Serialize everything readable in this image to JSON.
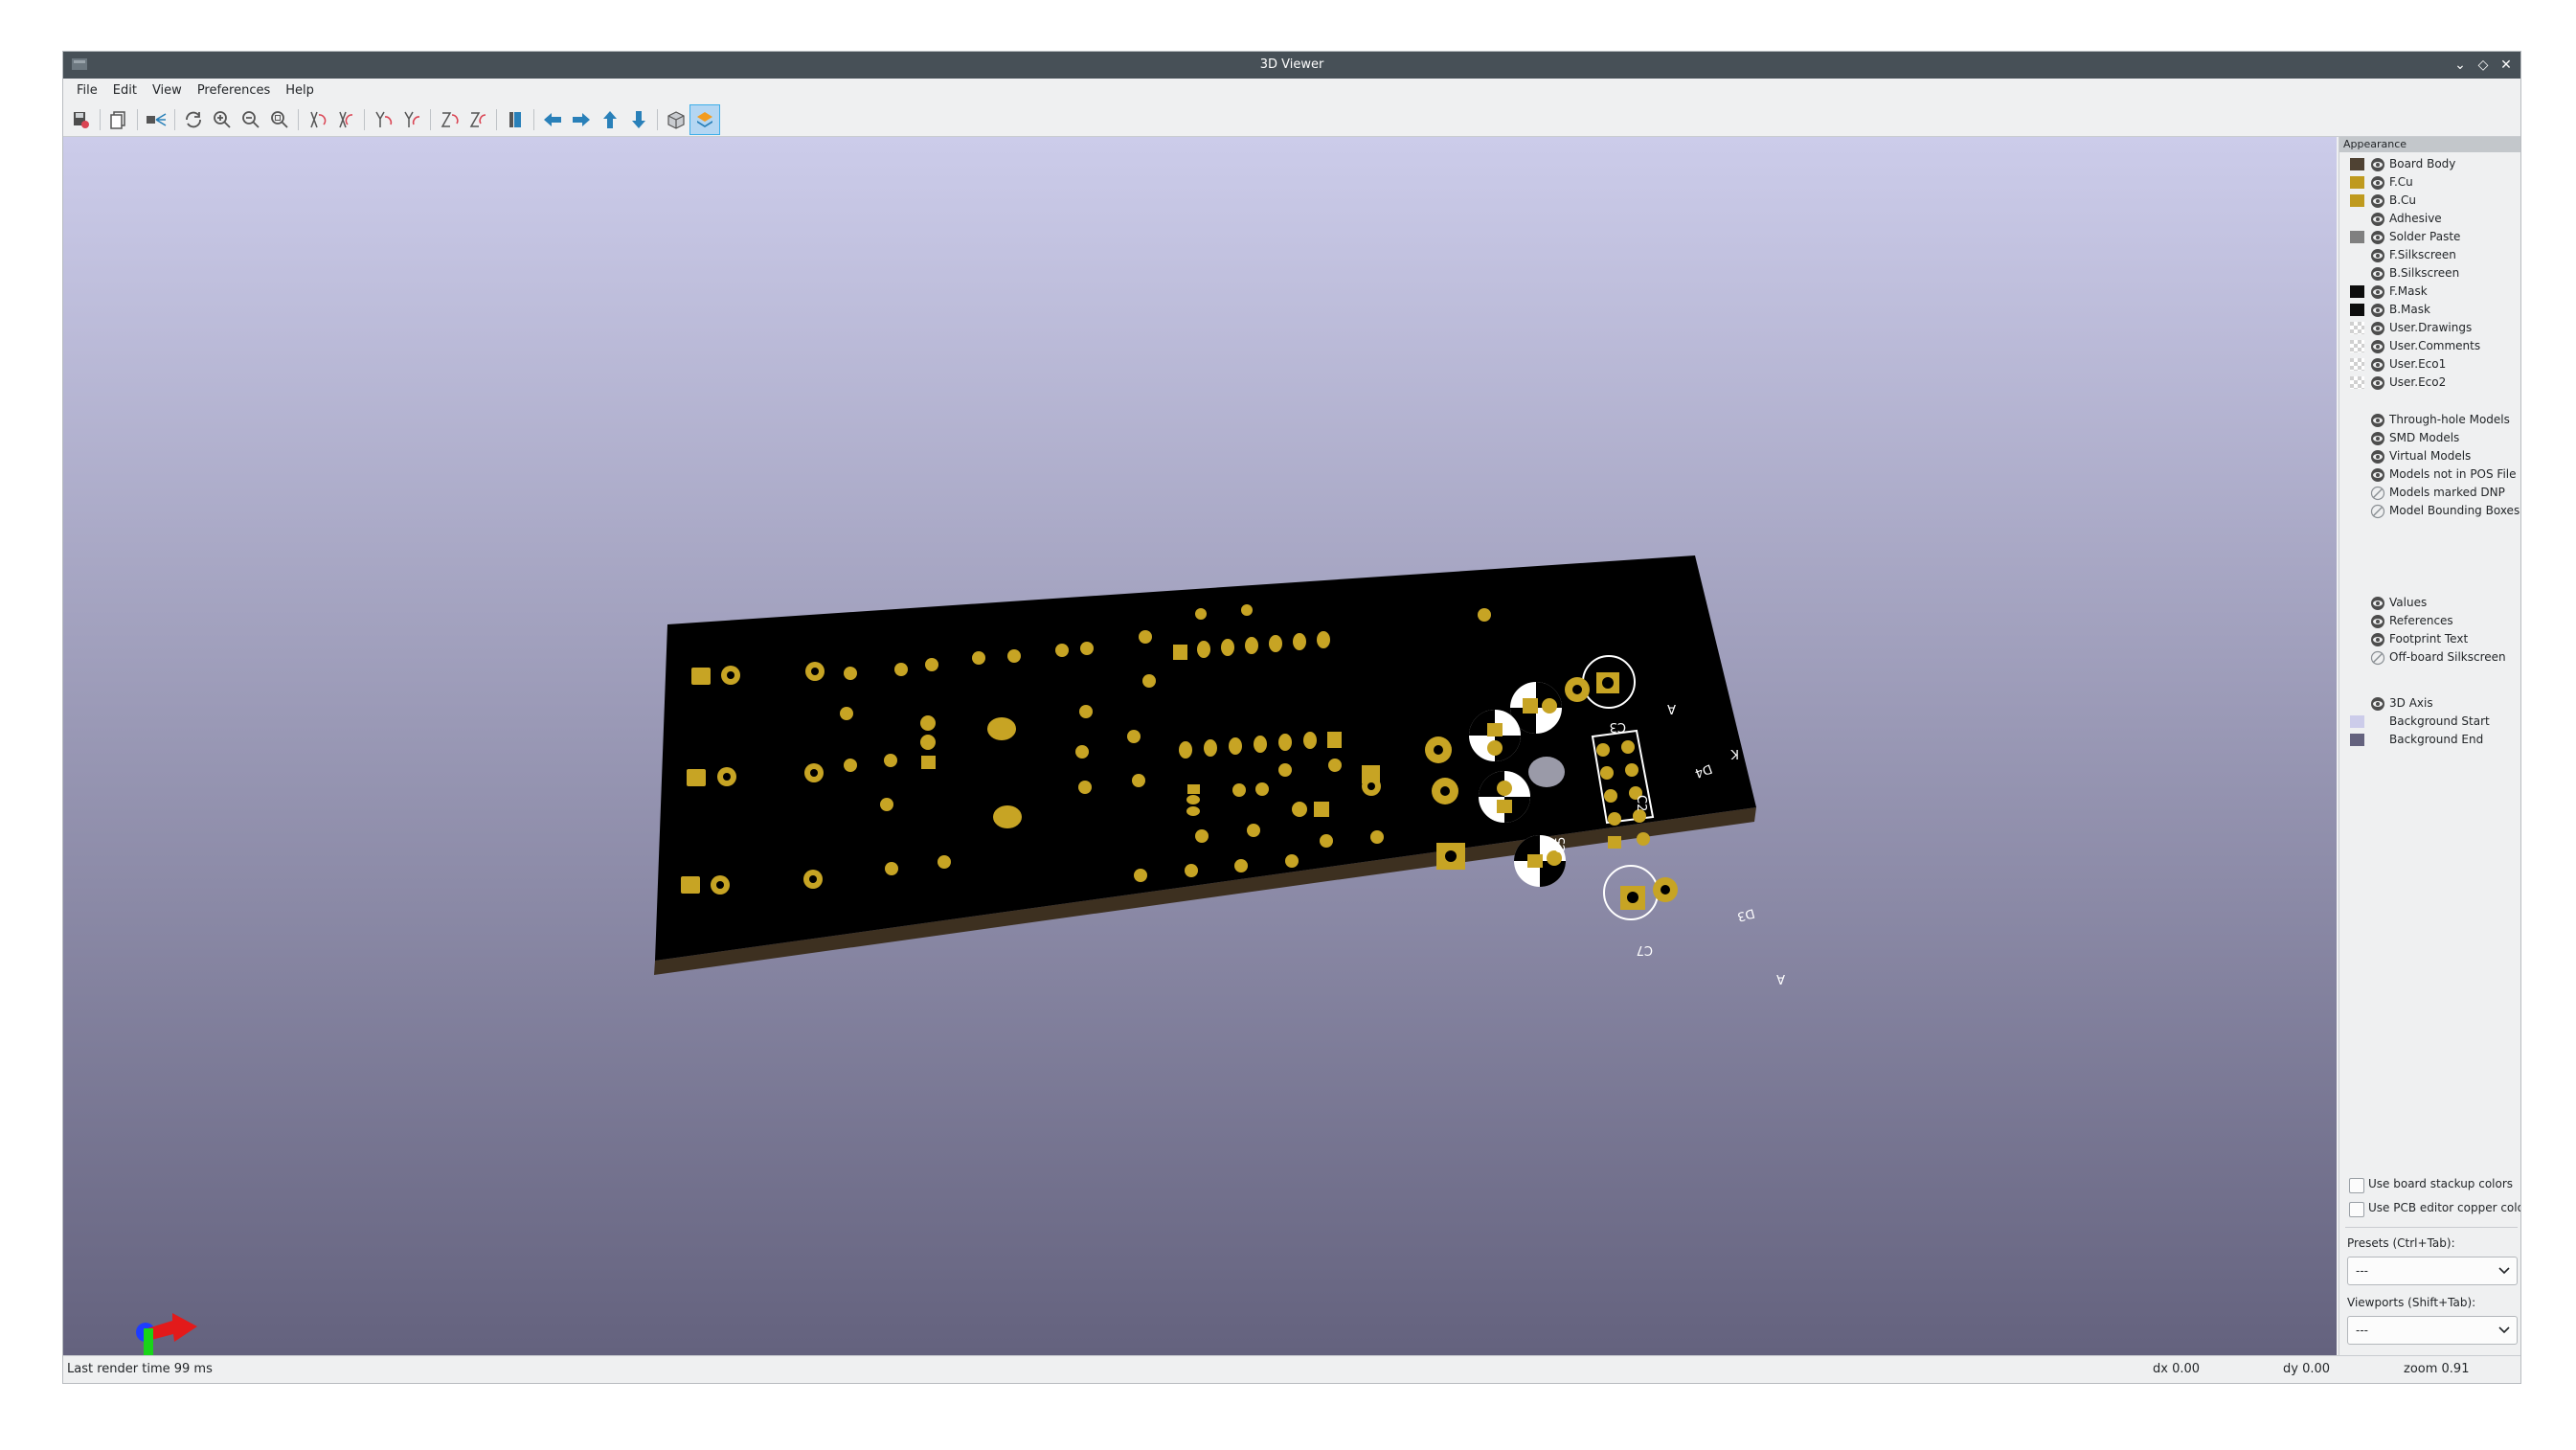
{
  "window": {
    "title": "3D Viewer"
  },
  "menu": [
    "File",
    "Edit",
    "View",
    "Preferences",
    "Help"
  ],
  "toolbar": {
    "buttons": [
      "save-image-icon",
      "copy-icon",
      "raytrace-icon",
      "reload-icon",
      "zoom-in-icon",
      "zoom-out-icon",
      "zoom-fit-icon",
      "rotate-x-cw-icon",
      "rotate-x-ccw-icon",
      "rotate-y-cw-icon",
      "rotate-y-ccw-icon",
      "rotate-z-cw-icon",
      "rotate-z-ccw-icon",
      "flip-board-icon",
      "pan-left-icon",
      "pan-right-icon",
      "pan-up-icon",
      "pan-down-icon",
      "ortho-icon",
      "layers-icon"
    ]
  },
  "appearance": {
    "title": "Appearance",
    "layers": [
      {
        "label": "Board Body",
        "color": "#4f4233",
        "visible": true
      },
      {
        "label": "F.Cu",
        "color": "#bf9a1e",
        "visible": true
      },
      {
        "label": "B.Cu",
        "color": "#bf9a1e",
        "visible": true
      },
      {
        "label": "Adhesive",
        "color": "",
        "visible": true
      },
      {
        "label": "Solder Paste",
        "color": "#808080",
        "visible": true
      },
      {
        "label": "F.Silkscreen",
        "color": "",
        "visible": true
      },
      {
        "label": "B.Silkscreen",
        "color": "",
        "visible": true
      },
      {
        "label": "F.Mask",
        "color": "#0d0d0d",
        "visible": true
      },
      {
        "label": "B.Mask",
        "color": "#0d0d0d",
        "visible": true
      },
      {
        "label": "User.Drawings",
        "color": "checker",
        "visible": true
      },
      {
        "label": "User.Comments",
        "color": "checker",
        "visible": true
      },
      {
        "label": "User.Eco1",
        "color": "checker",
        "visible": true
      },
      {
        "label": "User.Eco2",
        "color": "checker",
        "visible": true
      }
    ],
    "models": [
      {
        "label": "Through-hole Models",
        "visible": true
      },
      {
        "label": "SMD Models",
        "visible": true
      },
      {
        "label": "Virtual Models",
        "visible": true
      },
      {
        "label": "Models not in POS File",
        "visible": true
      },
      {
        "label": "Models marked DNP",
        "visible": false
      },
      {
        "label": "Model Bounding Boxes",
        "visible": false
      }
    ],
    "text": [
      {
        "label": "Values",
        "visible": true
      },
      {
        "label": "References",
        "visible": true
      },
      {
        "label": "Footprint Text",
        "visible": true
      },
      {
        "label": "Off-board Silkscreen",
        "visible": false
      }
    ],
    "misc": [
      {
        "label": "3D Axis",
        "color": "",
        "visible": true
      },
      {
        "label": "Background Start",
        "color": "#ccccea",
        "visible": null
      },
      {
        "label": "Background End",
        "color": "#64627e",
        "visible": null
      }
    ],
    "use_stackup": "Use board stackup colors",
    "use_pcb_copper": "Use PCB editor copper color",
    "presets_label": "Presets (Ctrl+Tab):",
    "presets_value": "---",
    "viewports_label": "Viewports (Shift+Tab):",
    "viewports_value": "---"
  },
  "board": {
    "silk_labels": [
      "C3",
      "C2",
      "C5",
      "C7",
      "D4",
      "D3",
      "A",
      "K",
      "A"
    ]
  },
  "status": {
    "render_time": "Last render time 99 ms",
    "dx": "dx 0.00",
    "dy": "dy 0.00",
    "zoom": "zoom 0.91"
  }
}
